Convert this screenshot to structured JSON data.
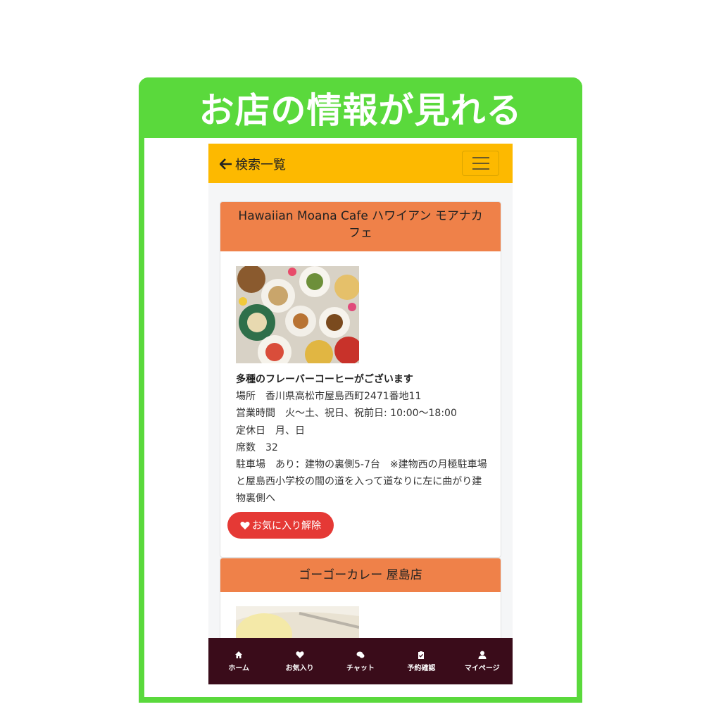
{
  "banner": {
    "title": "お店の情報が見れる"
  },
  "navbar": {
    "back_label": "検索一覧",
    "back_icon": "arrow-left-icon",
    "menu_icon": "hamburger-icon"
  },
  "shops": [
    {
      "name": "Hawaiian Moana Cafe ハワイアン モアナカフェ",
      "lead": "多種のフレーバーコーヒーがございます",
      "lines": [
        "場所　香川県高松市屋島西町2471番地11",
        "営業時間　火〜土、祝日、祝前日: 10:00〜18:00",
        "定休日　月、日",
        "席数　32",
        "駐車場　あり：建物の裏側5-7台　※建物西の月極駐車場と屋島西小学校の間の道を入って道なりに左に曲がり建物裏側へ"
      ],
      "fav_button": "お気に入り解除"
    },
    {
      "name": "ゴーゴーカレー 屋島店"
    }
  ],
  "footer": {
    "tabs": [
      {
        "label": "ホーム",
        "icon": "home-icon"
      },
      {
        "label": "お気入り",
        "icon": "heart-icon"
      },
      {
        "label": "チャット",
        "icon": "chat-icon"
      },
      {
        "label": "予約確認",
        "icon": "clipboard-check-icon"
      },
      {
        "label": "マイページ",
        "icon": "user-icon"
      }
    ]
  },
  "colors": {
    "banner": "#5ad93c",
    "navbar": "#fdb900",
    "card_header": "#ef8149",
    "fav_button": "#e53935",
    "footer": "#3a0c1a"
  }
}
